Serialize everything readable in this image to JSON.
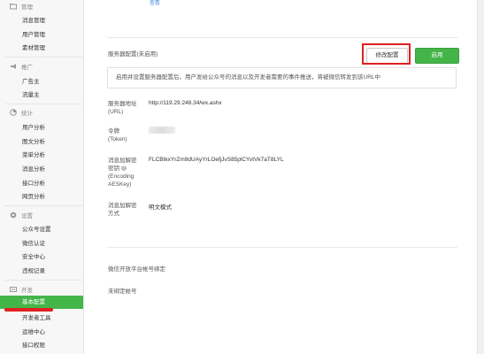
{
  "sidebar": {
    "sections": [
      {
        "title": "管理",
        "icon": "folder-icon",
        "items": [
          "消息管理",
          "用户管理",
          "素材管理"
        ]
      },
      {
        "title": "推广",
        "icon": "megaphone-icon",
        "items": [
          "广告主",
          "流量主"
        ]
      },
      {
        "title": "统计",
        "icon": "chart-icon",
        "items": [
          "用户分析",
          "图文分析",
          "菜单分析",
          "消息分析",
          "接口分析",
          "网页分析"
        ]
      },
      {
        "title": "设置",
        "icon": "gear-icon",
        "items": [
          "公众号设置",
          "微信认证",
          "安全中心",
          "违规记录"
        ]
      },
      {
        "title": "开发",
        "icon": "code-icon",
        "items": [
          "基本配置",
          "开发者工具",
          "运维中心",
          "接口权限"
        ]
      }
    ],
    "active_item": "基本配置"
  },
  "main": {
    "top_link": "查看",
    "server_config_title": "服务器配置(未启用)",
    "modify_button": "修改配置",
    "enable_button": "启用",
    "notice": "启用并设置服务器配置后，用户发给公众号的消息以及开发者需要的事件推送，将被微信转发到该URL中",
    "fields": {
      "url_label_1": "服务器地址",
      "url_label_2": "(URL)",
      "url_value": "http://119.29.248.34/wx.ashx",
      "token_label_1": "令牌",
      "token_label_2": "(Token)",
      "aes_label_1": "消息加解密",
      "aes_label_2": "密钥",
      "aes_label_3": "(Encoding",
      "aes_label_4": "AESKey)",
      "aes_value": "FLCBtkxYrZm9dUAyYrLOefjJvS85plCYvtVk7aT8LYL",
      "mode_label_1": "消息加解密",
      "mode_label_2": "方式",
      "mode_value": "明文模式"
    },
    "open_platform_label": "微信开放平台帐号绑定",
    "unbound_label": "未绑定帐号"
  },
  "colors": {
    "accent": "#44b549",
    "highlight": "#e02020"
  }
}
